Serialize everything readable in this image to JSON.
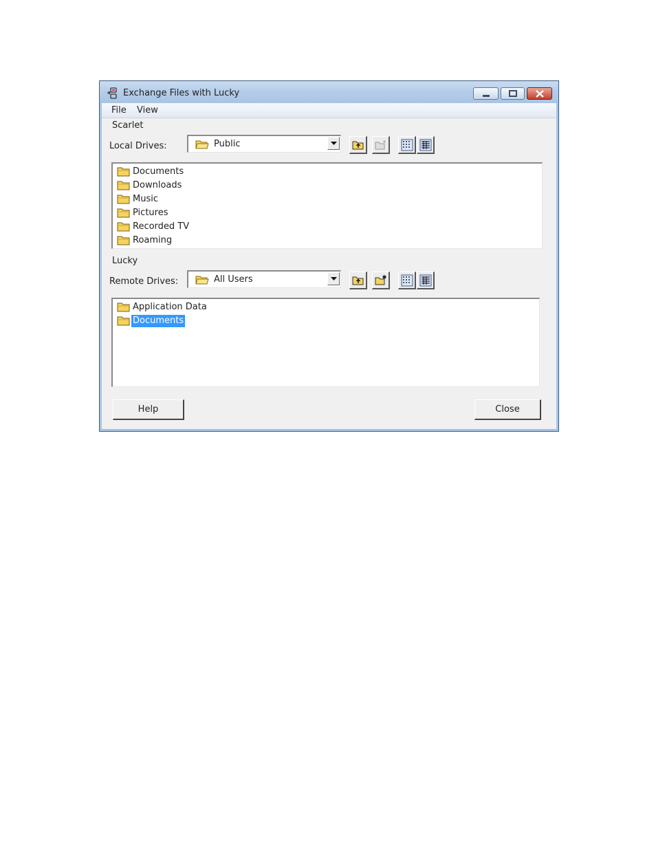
{
  "window": {
    "title": "Exchange Files with Lucky",
    "controls": {
      "minimize": "minimize",
      "maximize": "maximize",
      "close": "close"
    }
  },
  "menu": {
    "items": [
      "File",
      "View"
    ]
  },
  "local": {
    "machine_name": "Scarlet",
    "drives_label": "Local Drives:",
    "selected_drive": "Public",
    "folders": [
      "Documents",
      "Downloads",
      "Music",
      "Pictures",
      "Recorded TV",
      "Roaming"
    ]
  },
  "remote": {
    "machine_name": "Lucky",
    "drives_label": "Remote Drives:",
    "selected_drive": "All Users",
    "folders": [
      "Application Data",
      "Documents"
    ],
    "selected_folder": "Documents"
  },
  "buttons": {
    "help": "Help",
    "close": "Close"
  },
  "colors": {
    "selection": "#3399ff",
    "title_bar": "#b4cde9",
    "folder": "#f5d35e"
  }
}
